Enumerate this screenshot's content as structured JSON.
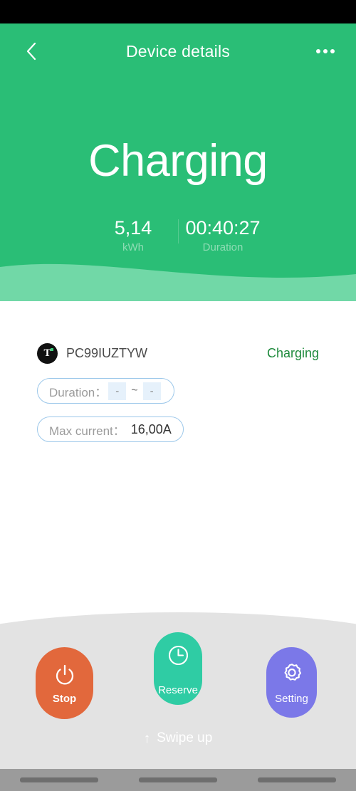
{
  "statusbar": {
    "present": true
  },
  "header": {
    "title": "Device details",
    "back_icon": "chevron-left-icon",
    "more_icon": "more-horizontal-icon",
    "background_color": "#2ABE76"
  },
  "hero": {
    "status_text": "Charging",
    "stats": [
      {
        "value": "5,14",
        "label": "kWh"
      },
      {
        "value": "00:40:27",
        "label": "Duration"
      }
    ]
  },
  "device": {
    "badge_letter": "T",
    "id": "PC99IUZTYW",
    "status": "Charging",
    "status_color": "#1E8A3C"
  },
  "chips": {
    "duration": {
      "label": "Duration：",
      "start": "-",
      "separator": "~",
      "end": "-"
    },
    "max_current": {
      "label": "Max current：",
      "value": "16,00A"
    }
  },
  "actions": [
    {
      "label": "Stop",
      "icon": "power-icon",
      "color": "#E2683C"
    },
    {
      "label": "Reserve",
      "icon": "clock-icon",
      "color": "#2FCCA4"
    },
    {
      "label": "Setting",
      "icon": "gear-icon",
      "color": "#7B78E8"
    }
  ],
  "sheet": {
    "swipe_arrow": "↑",
    "swipe_label": "Swipe up"
  }
}
